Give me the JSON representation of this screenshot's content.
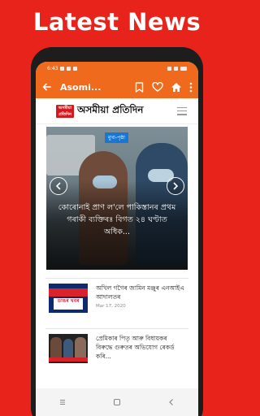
{
  "promo": {
    "title": "Latest News"
  },
  "status_bar": {
    "time": "6:43"
  },
  "app_bar": {
    "title": "Asomi..."
  },
  "publisher": {
    "logo_text_top": "অসমীয়া",
    "logo_text_bottom": "প্ৰতিদিন",
    "name": "অসমীয়া প্ৰতিদিন"
  },
  "featured": {
    "tag": "মুখ্য-পৃষ্ঠা",
    "headline": "কোৰোনাই প্ৰাণ ল'লে পাকিস্তানৰ প্ৰথম গৰাকী ব্যক্তিৰঃ বিগত ২৪ ঘণ্টাত অধিক..."
  },
  "news_items": [
    {
      "headline": "অখিল গগৈৰ জামিন মঞ্জুৰ এনআইএ আদালতৰ",
      "date": "Mar 17, 2020",
      "thumb_text": "ডাঙৰ খবৰ"
    },
    {
      "headline": "প্ৰেমিকাৰ পিতৃ আৰু বিধায়কৰ বিৰুদ্ধে গুৰুতৰ অভিযোগ ৰেকৰ্ড কৰি..."
    }
  ],
  "colors": {
    "promo_bg": "#e8231b",
    "app_bar": "#f06a1d",
    "tag_bg": "#1976d2",
    "logo_red": "#d4181d"
  },
  "icons": {
    "back": "arrow-left-icon",
    "bookmark": "bookmark-icon",
    "favorite": "heart-icon",
    "home": "home-icon",
    "more": "more-vert-icon",
    "menu": "hamburger-menu-icon"
  }
}
